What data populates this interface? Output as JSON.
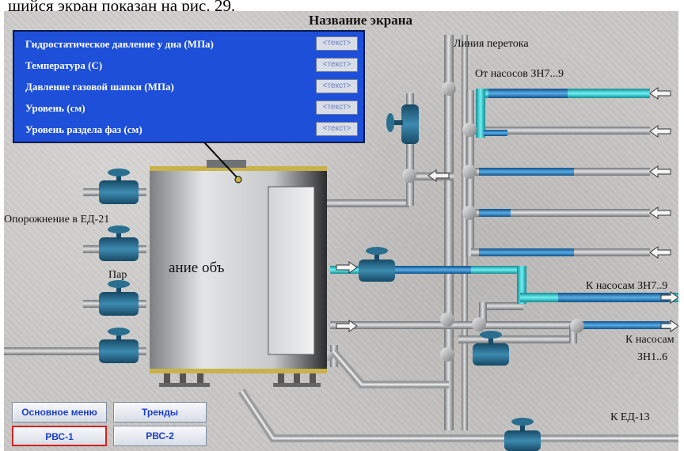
{
  "doc_caption": "шийся экран показан на рис. 29.",
  "screen": {
    "title": "Название экрана",
    "tank_label": "ание объ"
  },
  "parameters": [
    {
      "name": "Гидростатическое давление у дна (МПа)",
      "value": "<текст>"
    },
    {
      "name": "Температура (С)",
      "value": "<текст>"
    },
    {
      "name": "Давление газовой шапки  (МПа)",
      "value": "<текст>"
    },
    {
      "name": "Уровень (см)",
      "value": "<текст>"
    },
    {
      "name": "Уровень раздела фаз (см)",
      "value": "<текст>"
    }
  ],
  "labels": {
    "overflow_line": "Линия перетока",
    "from_pumps": "От насосов ЗН7...9",
    "drain": "Опорожнение в ЕД-21",
    "steam": "Пар",
    "to_pumps_1": "К насосам ЗН7..9",
    "to_pumps_2a": "К насосам",
    "to_pumps_2b": "ЗН1..6",
    "to_ed13": "К ЕД-13"
  },
  "buttons": {
    "main_menu": "Основное меню",
    "trends": "Тренды",
    "rvs1": "РВС-1",
    "rvs2": "РВС-2"
  },
  "colors": {
    "background": "#c9c8c6",
    "panel": "#1d4fd8",
    "pipe": "#9a9c9e",
    "flow": "#2d86c9",
    "flow_highlight": "#2ec8d0",
    "valve": "#2a6f8f"
  }
}
